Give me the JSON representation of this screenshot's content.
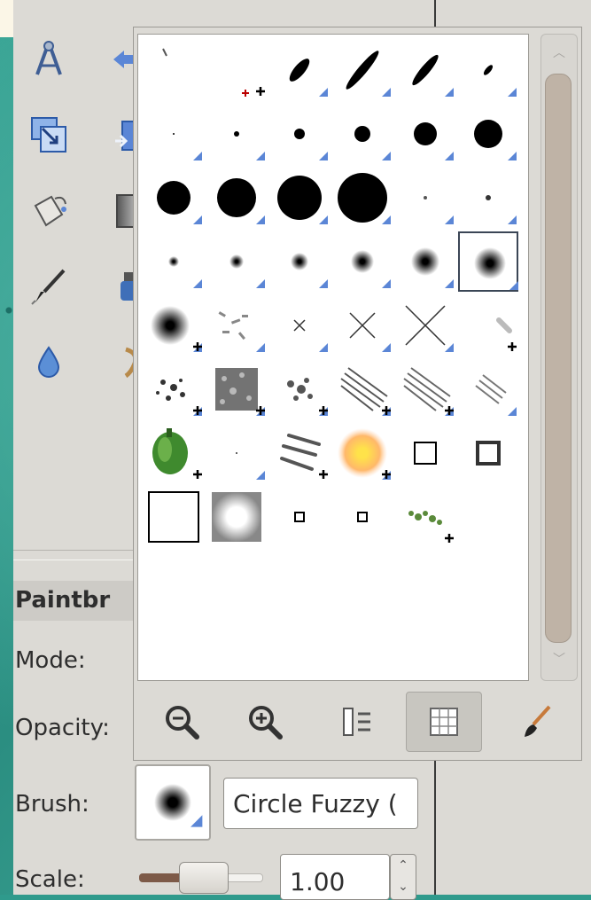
{
  "tool_options": {
    "title": "Paintbr",
    "mode_label": "Mode:",
    "opacity_label": "Opacity:",
    "brush_label": "Brush:",
    "brush_name": "Circle Fuzzy (",
    "scale_label": "Scale:",
    "scale_value": "1.00",
    "scale_fraction": 0.35
  },
  "toolbox": {
    "icons": [
      "compass-icon",
      "move-icon",
      "scale-icon",
      "flip-icon",
      "bucket-fill-icon",
      "gradient-icon",
      "paintbrush-icon",
      "ink-icon",
      "blur-icon",
      "dodge-icon"
    ]
  },
  "brush_popup": {
    "selected_brush": "Circle Fuzzy",
    "brushes": [
      "Pencil Scratch",
      "Pencil Sketch",
      "Calligraphy 1",
      "Calligraphy 2",
      "Calligraphy 3",
      "Calligraphy 4",
      "Circle 01",
      "Circle 03",
      "Circle 05",
      "Circle 07",
      "Circle 09",
      "Circle 11",
      "Circle 13",
      "Circle 15",
      "Circle 17",
      "Circle 19",
      "Circle Fuzzy 01",
      "Circle Fuzzy 03",
      "Circle Fuzzy 05",
      "Circle Fuzzy 07",
      "Circle Fuzzy 09",
      "Circle Fuzzy 11",
      "Circle Fuzzy 13",
      "Circle Fuzzy",
      "Circle Fuzzy 19",
      "Confetti",
      "Cross Small",
      "Cross Medium",
      "Cross Large",
      "Diagonal Star",
      "Galaxy Small",
      "Galaxy Big",
      "Galaxy",
      "Hatch Prickle",
      "Hatch Medium",
      "Hatch",
      "Pepper",
      "Point",
      "Sponge",
      "Sparks",
      "Square Small",
      "Square Medium",
      "Square Large",
      "Square Fuzzy",
      "Square Tiny",
      "Square Tiny Hard",
      "Vine"
    ],
    "view_buttons": [
      "zoom-out-icon",
      "zoom-in-icon",
      "list-view-icon",
      "grid-view-icon",
      "edit-brush-icon"
    ],
    "active_view": "grid-view-icon"
  },
  "colors": {
    "panel": "#dcdad5",
    "selection": "#3b4656",
    "accent_blue": "#5b86d6",
    "slider_fill": "#7d5a48"
  }
}
